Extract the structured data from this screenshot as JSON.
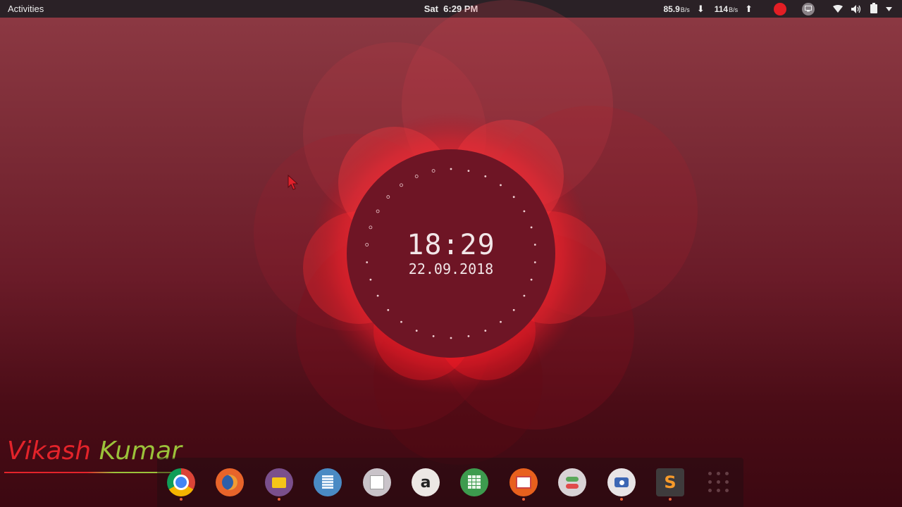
{
  "topbar": {
    "activities": "Activities",
    "day": "Sat",
    "time": "6:29 PM",
    "download_value": "85.9",
    "download_unit": "B/s",
    "download_arrow": "⬇",
    "upload_value": "114",
    "upload_unit": "B/s",
    "upload_arrow": "⬆",
    "icons": [
      "record-icon",
      "screen-icon",
      "wifi-icon",
      "volume-icon",
      "battery-icon",
      "chevron-down-icon"
    ]
  },
  "desktop": {
    "clock_time": "18:29",
    "clock_date": "22.09.2018"
  },
  "watermark": {
    "first": "Vikash",
    "second": "Kumar"
  },
  "dock": {
    "apps": [
      {
        "name": "chrome-icon",
        "label": "",
        "color": "#dd4b39",
        "running": true
      },
      {
        "name": "firefox-icon",
        "label": "",
        "color": "#e8642a",
        "running": false
      },
      {
        "name": "files-icon",
        "label": "",
        "color": "#7a4f8c",
        "running": true
      },
      {
        "name": "text-editor-icon",
        "label": "",
        "color": "#4a8ac4",
        "running": false
      },
      {
        "name": "text-edit-app-icon",
        "label": "",
        "color": "#c9c3c9",
        "running": false
      },
      {
        "name": "amazon-icon",
        "label": "a",
        "color": "#ece7e4",
        "running": false
      },
      {
        "name": "spreadsheet-icon",
        "label": "",
        "color": "#3d9b4e",
        "running": false
      },
      {
        "name": "presentation-icon",
        "label": "",
        "color": "#e8601d",
        "running": true
      },
      {
        "name": "settings-toggle-icon",
        "label": "",
        "color": "#d9d3d6",
        "running": false
      },
      {
        "name": "screenshot-icon",
        "label": "",
        "color": "#e8e4e6",
        "running": true
      },
      {
        "name": "sublime-text-icon",
        "label": "S",
        "color": "#3e3b3c",
        "running": true
      }
    ],
    "show_apps": "show-applications-icon"
  }
}
